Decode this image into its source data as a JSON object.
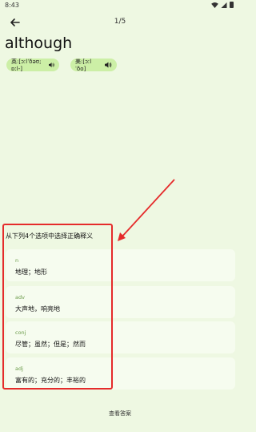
{
  "status_bar": {
    "time": "8:43"
  },
  "header": {
    "progress": "1/5"
  },
  "word": "although",
  "pronunciations": [
    {
      "label": "英:[ɔːlˈðəʊ; ɒːl-]"
    },
    {
      "label": "美:[ɔːlˈðo]"
    }
  ],
  "question": "从下列4个选项中选择正确释义",
  "options": [
    {
      "pos": "n",
      "definition": "地理；地形"
    },
    {
      "pos": "adv",
      "definition": "大声地，响亮地"
    },
    {
      "pos": "conj",
      "definition": "尽管；虽然；但是；然而"
    },
    {
      "pos": "adj",
      "definition": "富有的；充分的；丰裕的"
    }
  ],
  "footer": {
    "view_answer": "查看答案"
  },
  "colors": {
    "background": "#eef8e2",
    "pill": "#ccefa6",
    "annotation": "#e52b2b",
    "pos_text": "#6a9a48"
  }
}
